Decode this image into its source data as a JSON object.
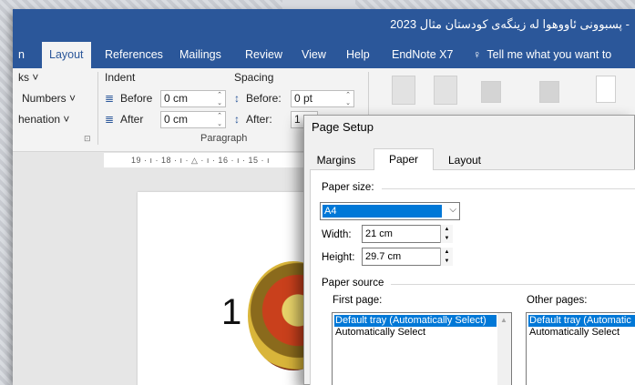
{
  "window": {
    "title": "- پسبوونی ئاووهوا له زینگەی کودستان مثال 2023"
  },
  "tabs": [
    {
      "label": "n"
    },
    {
      "label": "Layout"
    },
    {
      "label": "References"
    },
    {
      "label": "Mailings"
    },
    {
      "label": "Review"
    },
    {
      "label": "View"
    },
    {
      "label": "Help"
    },
    {
      "label": "EndNote X7"
    },
    {
      "label": "Tell me what you want to"
    }
  ],
  "ribbon": {
    "breaks": "ks ˅",
    "line_numbers": "Numbers ˅",
    "hyphenation": "henation ˅",
    "indent_header": "Indent",
    "indent_before_label": "Before",
    "indent_before_value": "0 cm",
    "indent_after_label": "After",
    "indent_after_value": "0 cm",
    "spacing_header": "Spacing",
    "spacing_before_label": "Before:",
    "spacing_before_value": "0 pt",
    "spacing_after_label": "After:",
    "spacing_after_value": "1",
    "paragraph_group": "Paragraph"
  },
  "ruler": {
    "text": "19 · ı · 18 · ı · △ · ı · 16 · ı · 15 · ı"
  },
  "document": {
    "page_number": "1"
  },
  "dialog": {
    "title": "Page Setup",
    "tabs": [
      "Margins",
      "Paper",
      "Layout"
    ],
    "paper_size_label": "Paper size:",
    "paper_size_value": "A4",
    "width_label": "Width:",
    "width_value": "21 cm",
    "height_label": "Height:",
    "height_value": "29.7 cm",
    "paper_source_label": "Paper source",
    "first_page_label": "First page:",
    "first_page_items": [
      "Default tray (Automatically Select)",
      "Automatically Select"
    ],
    "other_pages_label": "Other pages:",
    "other_pages_items": [
      "Default tray (Automatic",
      "Automatically Select"
    ]
  }
}
